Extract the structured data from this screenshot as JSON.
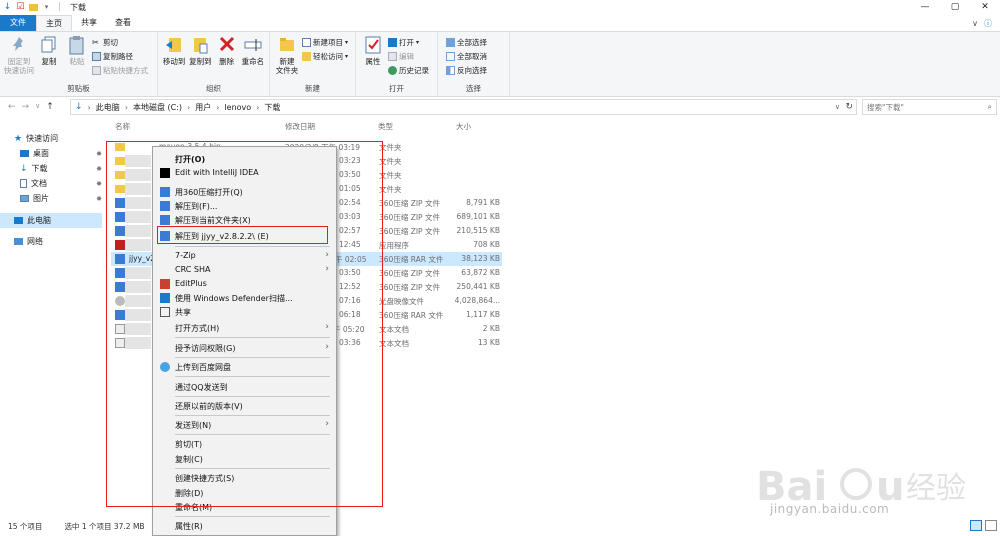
{
  "window": {
    "title": "下载",
    "controls": [
      "—",
      "▢",
      "✕"
    ]
  },
  "tabs": [
    {
      "label": "文件"
    },
    {
      "label": "主页"
    },
    {
      "label": "共享"
    },
    {
      "label": "查看"
    }
  ],
  "ribbon": {
    "clipboard": {
      "pin_label": "固定到\n快速访问",
      "copy_label": "复制",
      "paste_label": "粘贴",
      "cut_label": "剪切",
      "copy_path_label": "复制路径",
      "paste_shortcut_label": "粘贴快捷方式",
      "group_label": "剪贴板"
    },
    "organize": {
      "move_to_label": "移动到",
      "copy_to_label": "复制到",
      "delete_label": "删除",
      "rename_label": "重命名",
      "group_label": "组织"
    },
    "new": {
      "new_folder_label": "新建\n文件夹",
      "new_item_label": "新建项目",
      "easy_access_label": "轻松访问",
      "group_label": "新建"
    },
    "open": {
      "properties_label": "属性",
      "open_label": "打开",
      "edit_label": "编辑",
      "history_label": "历史记录",
      "group_label": "打开"
    },
    "select": {
      "select_all_label": "全部选择",
      "select_none_label": "全部取消",
      "invert_label": "反向选择",
      "group_label": "选择"
    }
  },
  "address": {
    "crumbs": [
      "此电脑",
      "本地磁盘 (C:)",
      "用户",
      "lenovo",
      "下载"
    ],
    "search_placeholder": "搜索\"下载\""
  },
  "nav": {
    "quick_access": "快速访问",
    "desktop": "桌面",
    "downloads": "下载",
    "documents": "文档",
    "pictures": "图片",
    "this_pc": "此电脑",
    "network": "网络"
  },
  "columns": {
    "name": "名称",
    "date": "修改日期",
    "type": "类型",
    "size": "大小"
  },
  "files": [
    {
      "name": "maven-3.5.4-bin",
      "date": "2020/3/8 下午 03:19",
      "type": "文件夹",
      "size": ""
    },
    {
      "name": "",
      "date": "03:23",
      "type": "文件夹",
      "size": ""
    },
    {
      "name": "",
      "date": "03:50",
      "type": "文件夹",
      "size": ""
    },
    {
      "name": "",
      "date": "01:05",
      "type": "文件夹",
      "size": ""
    },
    {
      "name": "",
      "date": "02:54",
      "type": "360压缩 ZIP 文件",
      "size": "8,791 KB"
    },
    {
      "name": "",
      "date": "03:03",
      "type": "360压缩 ZIP 文件",
      "size": "689,101 KB"
    },
    {
      "name": "",
      "date": "02:57",
      "type": "360压缩 ZIP 文件",
      "size": "210,515 KB"
    },
    {
      "name": "",
      "date": "12:45",
      "type": "应用程序",
      "size": "708 KB"
    },
    {
      "name": "jjyy_v2",
      "date": "午 02:05",
      "type": "360压缩 RAR 文件",
      "size": "38,123 KB"
    },
    {
      "name": "",
      "date": "03:50",
      "type": "360压缩 ZIP 文件",
      "size": "63,872 KB"
    },
    {
      "name": "",
      "date": "12:52",
      "type": "360压缩 ZIP 文件",
      "size": "250,441 KB"
    },
    {
      "name": "",
      "date": "07:16",
      "type": "光盘映像文件",
      "size": "4,028,864..."
    },
    {
      "name": "",
      "date": "06:18",
      "type": "360压缩 RAR 文件",
      "size": "1,117 KB"
    },
    {
      "name": "",
      "date": "午 05:20",
      "type": "文本文档",
      "size": "2 KB"
    },
    {
      "name": "",
      "date": "03:36",
      "type": "文本文档",
      "size": "13 KB"
    }
  ],
  "context_menu": [
    {
      "label": "打开(O)",
      "bold": true
    },
    {
      "label": "Edit with IntelliJ IDEA"
    },
    {
      "label": "用360压缩打开(Q)"
    },
    {
      "label": "解压到(F)..."
    },
    {
      "label": "解压到当前文件夹(X)"
    },
    {
      "label": "解压到 jjyy_v2.8.2.2\\ (E)"
    },
    {
      "label": "7-Zip",
      "submenu": true
    },
    {
      "label": "CRC SHA",
      "submenu": true
    },
    {
      "label": "EditPlus"
    },
    {
      "label": "使用 Windows Defender扫描..."
    },
    {
      "label": "共享"
    },
    {
      "label": "打开方式(H)",
      "submenu": true
    },
    {
      "label": "授予访问权限(G)",
      "submenu": true
    },
    {
      "label": "上传到百度网盘"
    },
    {
      "label": "通过QQ发送到"
    },
    {
      "label": "还原以前的版本(V)"
    },
    {
      "label": "发送到(N)",
      "submenu": true
    },
    {
      "label": "剪切(T)"
    },
    {
      "label": "复制(C)"
    },
    {
      "label": "创建快捷方式(S)"
    },
    {
      "label": "删除(D)"
    },
    {
      "label": "重命名(M)"
    },
    {
      "label": "属性(R)"
    }
  ],
  "status": {
    "count": "15 个项目",
    "selected": "选中 1 个项目  37.2 MB"
  },
  "watermark": {
    "text": "jingyan.baidu.com"
  },
  "colors": {
    "accent": "#1979ca",
    "selection": "#cce8ff",
    "annotation": "#e02020"
  }
}
